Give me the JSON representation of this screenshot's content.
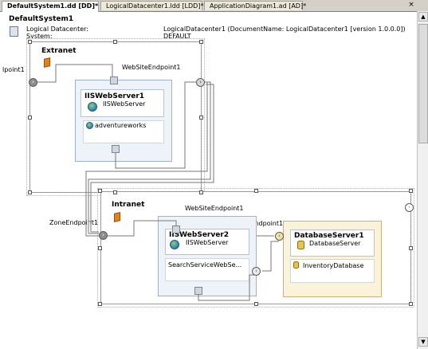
{
  "tabs": [
    {
      "label": "DefaultSystem1.dd [DD]*",
      "active": true
    },
    {
      "label": "LogicalDatacenter1.ldd [LDD]*",
      "active": false
    },
    {
      "label": "ApplicationDiagram1.ad [AD]*",
      "active": false
    }
  ],
  "close_glyph": "×",
  "diagram_title": "DefaultSystem1",
  "info": {
    "left_line1": "Logical Datacenter:",
    "left_line2": "System:",
    "right_line1": "LogicalDatacenter1 (DocumentName: LogicalDatacenter1 [version 1.0.0.0])",
    "right_line2": "DEFAULT"
  },
  "extranet": {
    "title": "Extranet",
    "left_endpoint": "lpoint1",
    "website_endpoint": "WebSiteEndpoint1",
    "server": {
      "name": "IISWebServer1",
      "type": "IISWebServer",
      "app": "adventureworks"
    }
  },
  "intranet": {
    "title": "Intranet",
    "zone_endpoint": "ZoneEndpoint1",
    "website_endpoint": "WebSiteEndpoint1",
    "dbserver_endpoint": "DatabaseServerEndpoint1",
    "server": {
      "name": "IISWebServer2",
      "type": "IISWebServer",
      "app": "SearchServiceWebSe..."
    },
    "db": {
      "name": "DatabaseServer1",
      "type": "DatabaseServer",
      "app": "InventoryDatabase"
    }
  },
  "icons": {
    "zone_icon": "orange-zone-icon",
    "server_icon": "globe-server-icon",
    "db_icon": "database-icon",
    "system_icon": "system-icon"
  },
  "colors": {
    "server_fill": "#eef3fa",
    "db_fill": "#fbf3d9",
    "zone_icon": "#e4811c"
  }
}
